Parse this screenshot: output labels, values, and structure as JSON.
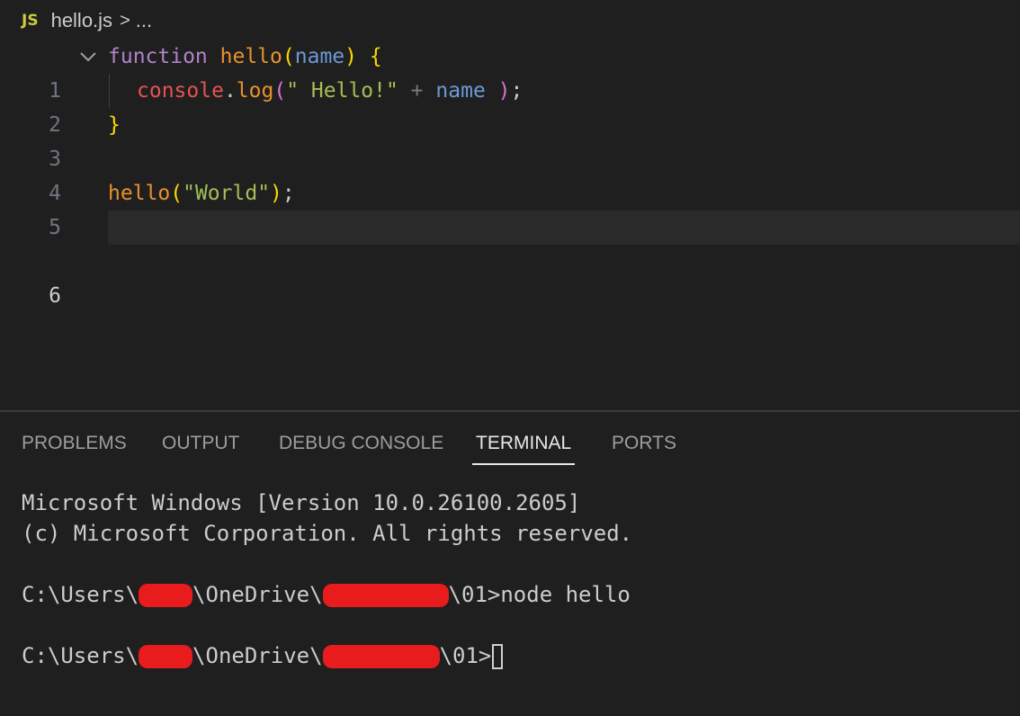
{
  "breadcrumb": {
    "icon_text": "JS",
    "file": "hello.js",
    "separator": ">",
    "more": "..."
  },
  "editor": {
    "lines": [
      {
        "number": "1"
      },
      {
        "number": "2"
      },
      {
        "number": "3"
      },
      {
        "number": "4"
      },
      {
        "number": "5"
      },
      {
        "number": "6"
      }
    ],
    "current_line": 6,
    "tokens": {
      "l1_kw": "function",
      "l1_fn": "hello",
      "l1_open": "(",
      "l1_param": "name",
      "l1_close": ")",
      "l1_brace": "{",
      "l2_obj": "console",
      "l2_dot": ".",
      "l2_method": "log",
      "l2_open": "(",
      "l2_str": "\" Hello!\"",
      "l2_op": "+",
      "l2_var": "name",
      "l2_close": ")",
      "l2_semi": ";",
      "l3_brace": "}",
      "l5_fn": "hello",
      "l5_open": "(",
      "l5_str": "\"World\"",
      "l5_close": ")",
      "l5_semi": ";"
    }
  },
  "panel": {
    "tabs": [
      {
        "label": "PROBLEMS"
      },
      {
        "label": "OUTPUT"
      },
      {
        "label": "DEBUG CONSOLE"
      },
      {
        "label": "TERMINAL",
        "active": true
      },
      {
        "label": "PORTS"
      }
    ]
  },
  "terminal": {
    "line1": "Microsoft Windows [Version 10.0.26100.2605]",
    "line2": "(c) Microsoft Corporation. All rights reserved.",
    "prompt1_a": "C:\\Users\\",
    "prompt1_b": "\\OneDrive\\",
    "prompt1_c": "\\01>node hello",
    "prompt2_a": "C:\\Users\\",
    "prompt2_b": "\\OneDrive\\",
    "prompt2_c": "\\01>"
  },
  "colors": {
    "background": "#1f1f1f",
    "keyword": "#b083c9",
    "function": "#e8912d",
    "string": "#a3be55",
    "redaction": "#e81c1c"
  }
}
